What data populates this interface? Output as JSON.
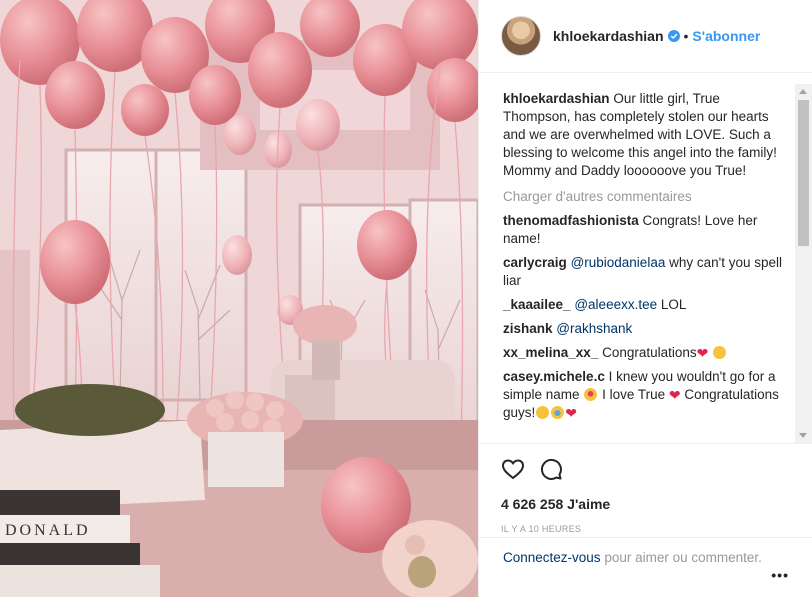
{
  "header": {
    "username": "khloekardashian",
    "separator": "•",
    "follow_label": "S'abonner"
  },
  "caption": {
    "username": "khloekardashian",
    "text": "Our little girl, True Thompson, has completely stolen our hearts and we are overwhelmed with LOVE. Such a blessing to welcome this angel into the family! Mommy and Daddy loooooove you True!"
  },
  "load_more": "Charger d'autres commentaires",
  "comments": [
    {
      "user": "thenomadfashionista",
      "text": "Congrats! Love her name!"
    },
    {
      "user": "carlycraig",
      "mention": "@rubiodanielaa",
      "text": "why can't you spell liar"
    },
    {
      "user": "_kaaailee_",
      "mention": "@aleeexx.tee",
      "text": "LOL"
    },
    {
      "user": "zishank",
      "mention": "@rakhshank",
      "text": ""
    },
    {
      "user": "xx_melina_xx_",
      "text": "Congratulations"
    },
    {
      "user": "casey.michele.c",
      "text": "I knew you wouldn't go for a simple name",
      "text2": "I love True",
      "text3": "Congratulations guys!"
    }
  ],
  "likes": "4 626 258 J'aime",
  "timestamp": "IL Y A 10 HEURES",
  "footer": {
    "login_label": "Connectez-vous",
    "rest": "pour aimer ou commenter.",
    "options": "•••"
  },
  "icons": {
    "verified": "verified-badge-icon",
    "like": "heart-icon",
    "comment": "comment-bubble-icon"
  },
  "colors": {
    "accent": "#3897f0",
    "link": "#003569",
    "muted": "#999999"
  }
}
